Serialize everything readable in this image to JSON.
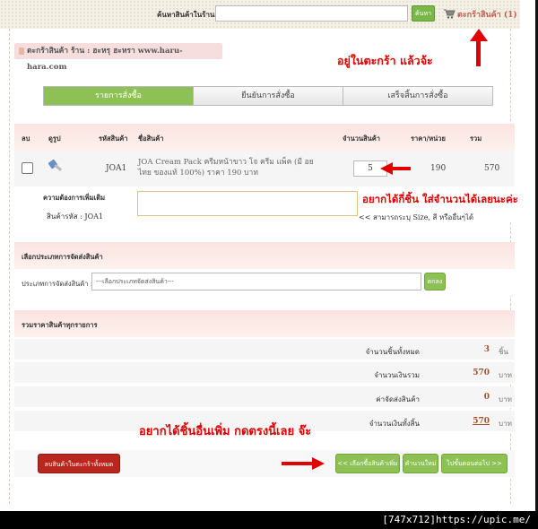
{
  "topbar": {
    "search_label": "ค้นหาสินค้าในร้าน :",
    "search_value": "",
    "search_button": "ค้นหา",
    "cart_link": "ตะกร้าสินค้า (1)"
  },
  "shop_title": "ตะกร้าสินค้า ร้าน : ฮะหรุ ฮะหรา www.haru-hara.com",
  "annotations": {
    "in_cart": "อยู่ในตะกร้า แล้วจ้ะ",
    "quantity_hint": "อยากได้กี่ชิ้น ใส่จำนวนได้เลยนะค่ะ",
    "more_items": "อยากได้ชิ้นอื่นเพิ่ม กดตรงนี้เลย จ๊ะ"
  },
  "steps": [
    "รายการสั่งซื้อ",
    "ยืนยันการสั่งซื้อ",
    "เสร็จสิ้นการสั่งซื้อ"
  ],
  "table": {
    "headers": {
      "delete": "ลบ",
      "image": "ดูรูป",
      "code": "รหัสสินค้า",
      "name": "ชื่อสินค้า",
      "qty": "จำนวนสินค้า",
      "price": "ราคา/หน่วย",
      "total": "รวม"
    },
    "item": {
      "code": "JOA1",
      "name": "JOA Cream Pack ครีมหน้าขาว โจ ครีม แพ็ค (มี อย ไทย ของแท้ 100%) ราคา 190 บาท",
      "qty": "5",
      "price": "190",
      "total": "570"
    },
    "extra": {
      "label": "ความต้องการเพิ่มเติม",
      "code_label": "สินค้ารหัส : JOA1",
      "note_value": "",
      "hint": "<< สามารถระบุ Size, สี หรืออื่นๆได้"
    }
  },
  "shipping": {
    "section_title": "เลือกประเภทการจัดส่งสินค้า",
    "label": "ประเภทการจัดส่งสินค้า :",
    "selected": "---เลือกประเภทจัดส่งสินค้า---",
    "button": "ตกลง"
  },
  "summary": {
    "section_title": "รวมราคาสินค้าทุกรายการ",
    "rows": [
      {
        "label": "จำนวนชิ้นทั้งหมด",
        "value": "3",
        "unit": "ชิ้น"
      },
      {
        "label": "จำนวนเงินรวม",
        "value": "570",
        "unit": "บาท"
      },
      {
        "label": "ค่าจัดส่งสินค้า",
        "value": "0",
        "unit": "บาท"
      },
      {
        "label": "จำนวนเงินทั้งสิ้น",
        "value": "570",
        "unit": "บาท"
      }
    ]
  },
  "buttons": {
    "clear_cart": "ลบสินค้าในตะกร้าทั้งหมด",
    "continue_shopping": "<< เลือกซื้อสินค้าเพิ่ม",
    "recalculate": "คำนวนใหม่",
    "next_step": "ไปขั้นตอนต่อไป >>"
  },
  "footer": "[747x712]https://upic.me/",
  "colors": {
    "accent_green": "#8dc155",
    "annotation_red": "#e00000",
    "header_pink": "#fbe3e0",
    "danger_red": "#b8261e"
  }
}
